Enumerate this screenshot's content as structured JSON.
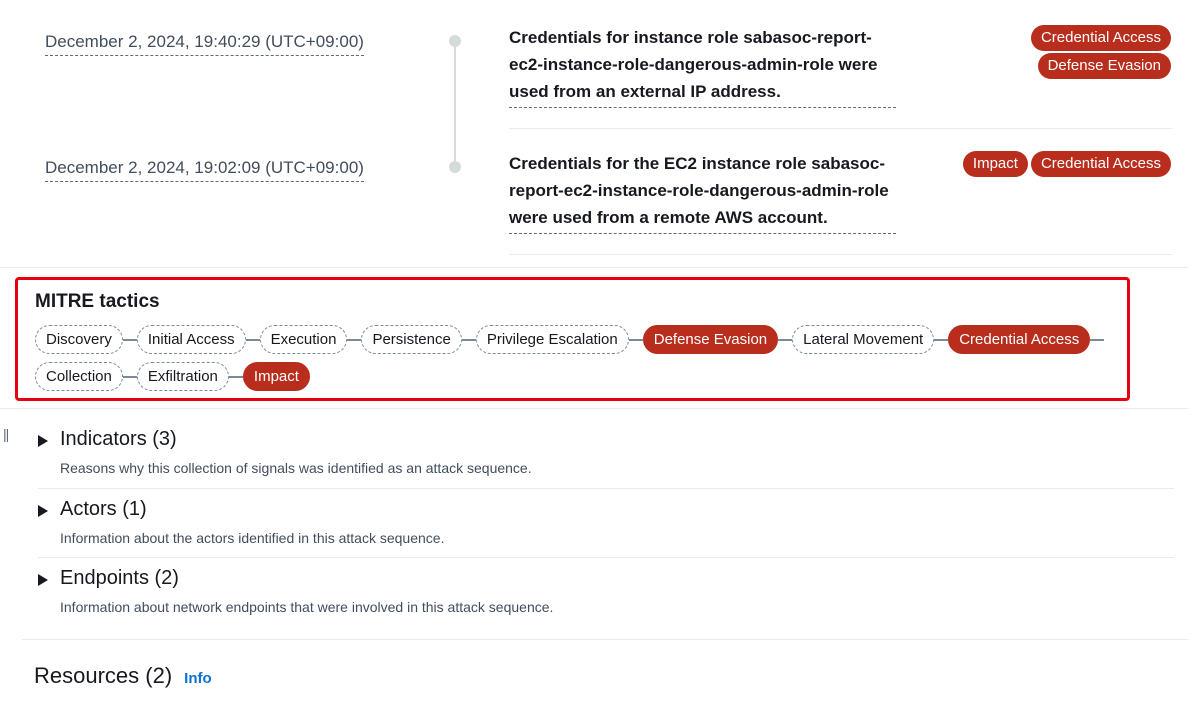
{
  "timeline": [
    {
      "timestamp": "December 2, 2024, 19:40:29 (UTC+09:00)",
      "description": "Credentials for instance role sabasoc-report-ec2-instance-role-dangerous-admin-role were used from an external IP address.",
      "tactics": [
        "Credential Access",
        "Defense Evasion"
      ]
    },
    {
      "timestamp": "December 2, 2024, 19:02:09 (UTC+09:00)",
      "description": "Credentials for the EC2 instance role sabasoc-report-ec2-instance-role-dangerous-admin-role were used from a remote AWS account.",
      "tactics": [
        "Impact",
        "Credential Access"
      ]
    }
  ],
  "mitre": {
    "title": "MITRE tactics",
    "tactics": [
      {
        "label": "Discovery",
        "active": false
      },
      {
        "label": "Initial Access",
        "active": false
      },
      {
        "label": "Execution",
        "active": false
      },
      {
        "label": "Persistence",
        "active": false
      },
      {
        "label": "Privilege Escalation",
        "active": false
      },
      {
        "label": "Defense Evasion",
        "active": true
      },
      {
        "label": "Lateral Movement",
        "active": false
      },
      {
        "label": "Credential Access",
        "active": true
      },
      {
        "label": "Collection",
        "active": false
      },
      {
        "label": "Exfiltration",
        "active": false
      },
      {
        "label": "Impact",
        "active": true
      }
    ]
  },
  "sections": [
    {
      "title": "Indicators (3)",
      "description": "Reasons why this collection of signals was identified as an attack sequence."
    },
    {
      "title": "Actors (1)",
      "description": "Information about the actors identified in this attack sequence."
    },
    {
      "title": "Endpoints (2)",
      "description": "Information about network endpoints that were involved in this attack sequence."
    }
  ],
  "resources": {
    "title": "Resources (2)",
    "info_label": "Info"
  },
  "pause_icon": "pause-icon",
  "colors": {
    "active_tactic": "#b92d1d",
    "highlight_border": "#e60012",
    "link": "#0972d3"
  }
}
